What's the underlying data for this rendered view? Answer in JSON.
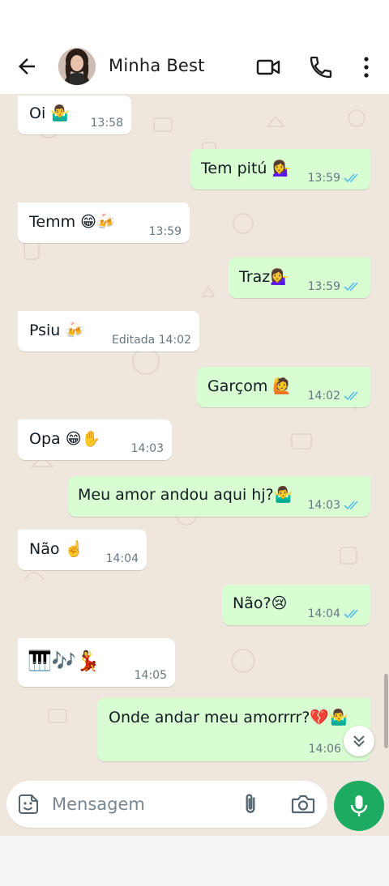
{
  "header": {
    "contact_name": "Minha Best"
  },
  "composer": {
    "placeholder": "Mensagem"
  },
  "messages": [
    {
      "text": "Oi 🤷‍♂️",
      "time": "13:58"
    },
    {
      "text": "Tem pitú 💁‍♀️",
      "time": "13:59"
    },
    {
      "text": "Temm 😁🍻",
      "time": "13:59"
    },
    {
      "text": "Traz💁‍♀️",
      "time": "13:59"
    },
    {
      "text": "Psiu 🍻",
      "time": "Editada 14:02"
    },
    {
      "text": "Garçom 🙋",
      "time": "14:02"
    },
    {
      "text": "Opa 😁✋",
      "time": "14:03"
    },
    {
      "text": "Meu amor andou aqui hj?🤷‍♂️",
      "time": "14:03"
    },
    {
      "text": "Não ☝️",
      "time": "14:04"
    },
    {
      "text": "Não?😢",
      "time": "14:04"
    },
    {
      "text": "🎹🎶💃",
      "time": "14:05"
    },
    {
      "text": "Onde andar meu amorrrr?💔🤷‍♂️",
      "time": "14:06"
    }
  ],
  "colors": {
    "incoming_bubble": "#ffffff",
    "outgoing_bubble": "#d9fdd3",
    "chat_background": "#efe7dd",
    "read_ticks": "#53bdeb",
    "mic_button": "#1daa61"
  },
  "icons": {
    "back": "arrow-left-icon",
    "video": "video-camera-icon",
    "call": "phone-icon",
    "more": "more-vert-icon",
    "sticker": "sticker-icon",
    "attach": "paperclip-icon",
    "camera": "camera-icon",
    "mic": "microphone-icon",
    "scroll": "chevrons-down-icon"
  }
}
